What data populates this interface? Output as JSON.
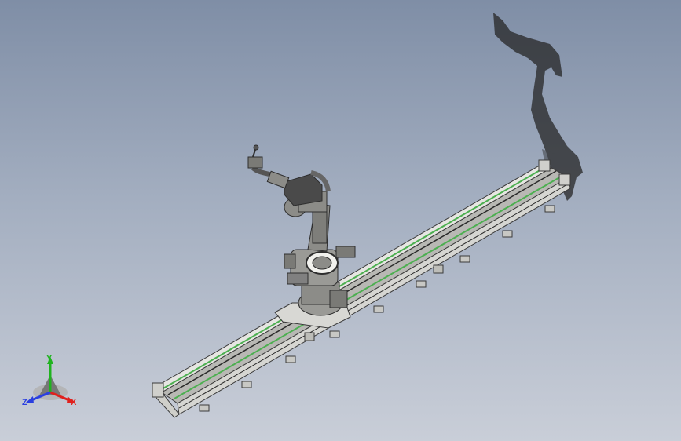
{
  "viewport": {
    "colors": {
      "background_top": "#7f8ea6",
      "background_bottom": "#c9ced8",
      "rail_body": "#c4c4c0",
      "rail_edge": "#3a3a3a",
      "rail_highlight": "#4caf50",
      "robot_body": "#8c8c88",
      "robot_dark": "#3c3c3c",
      "shadow": "#262626"
    }
  },
  "triad": {
    "x_label": "X",
    "y_label": "Y",
    "z_label": "Z",
    "x_color": "#e0201c",
    "y_color": "#1fb31f",
    "z_color": "#2a3fe0"
  },
  "model": {
    "objects": [
      "linear-rail-track",
      "six-axis-robot-arm",
      "robot-carriage",
      "ground-shadow"
    ]
  }
}
